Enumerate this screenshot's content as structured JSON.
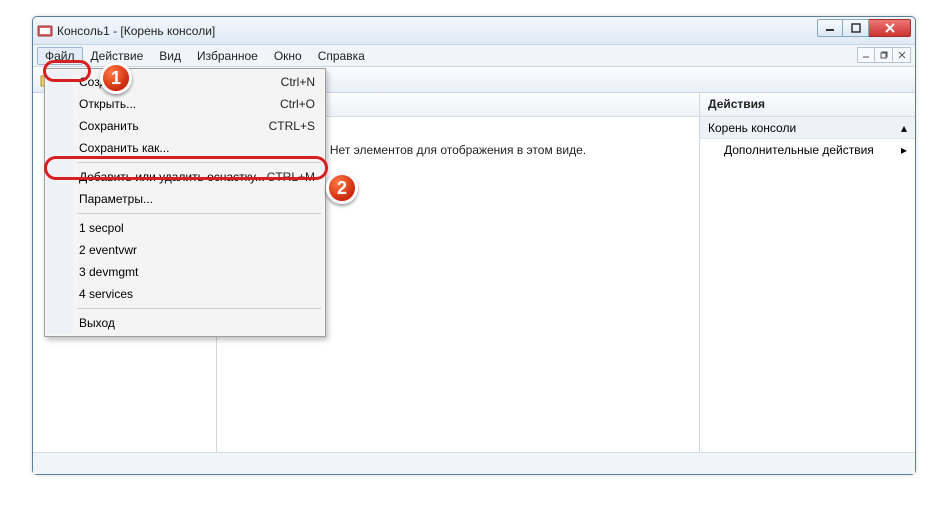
{
  "window": {
    "title": "Консоль1 - [Корень консоли]"
  },
  "menubar": {
    "file": "Файл",
    "action": "Действие",
    "view": "Вид",
    "favorites": "Избранное",
    "window": "Окно",
    "help": "Справка"
  },
  "dropdown": {
    "new": {
      "label": "Создать",
      "shortcut": "Ctrl+N"
    },
    "open": {
      "label": "Открыть...",
      "shortcut": "Ctrl+O"
    },
    "save": {
      "label": "Сохранить",
      "shortcut": "CTRL+S"
    },
    "saveas": {
      "label": "Сохранить как..."
    },
    "addremove": {
      "label": "Добавить или удалить оснастку...",
      "shortcut": "CTRL+M"
    },
    "params": {
      "label": "Параметры..."
    },
    "r1": "1 secpol",
    "r2": "2 eventvwr",
    "r3": "3 devmgmt",
    "r4": "4 services",
    "exit": "Выход"
  },
  "center": {
    "empty": "Нет элементов для отображения в этом виде."
  },
  "actions": {
    "header": "Действия",
    "section": "Корень консоли",
    "more": "Дополнительные действия"
  },
  "badges": {
    "one": "1",
    "two": "2"
  }
}
